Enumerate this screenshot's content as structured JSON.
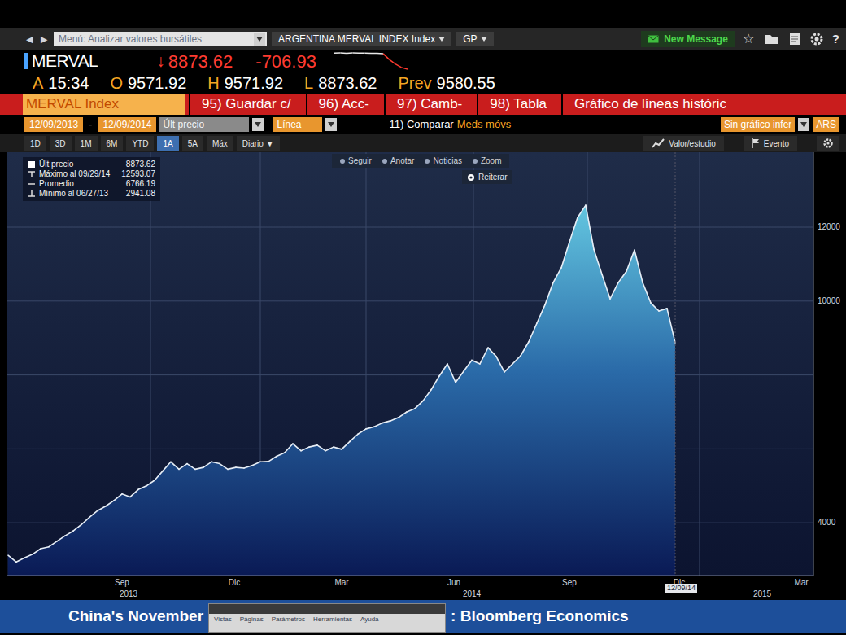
{
  "toolbar": {
    "nav": [
      "◀",
      "▶"
    ],
    "menu": "Menú: Analizar valores bursátiles",
    "security": "ARGENTINA MERVAL INDEX Index",
    "function": "GP",
    "new_message": "New Message",
    "star": "☆",
    "help": "?"
  },
  "quote": {
    "ticker": "MERVAL",
    "arrow": "↓",
    "last": "8873.62",
    "change": "-706.93",
    "time_label": "A",
    "time": "15:34",
    "open_label": "O",
    "open": "9571.92",
    "high_label": "H",
    "high": "9571.92",
    "low_label": "L",
    "low": "8873.62",
    "prev_label": "Prev",
    "prev": "9580.55"
  },
  "sparkline": {
    "values": [
      9580,
      9592,
      9575,
      9588,
      9580,
      9584,
      9570,
      9578,
      9560,
      9300,
      9100,
      8950,
      8873
    ]
  },
  "actions": {
    "title": "MERVAL Index",
    "buttons": [
      "95) Guardar c/",
      "96) Acc-",
      "97) Camb-",
      "98) Tabla"
    ],
    "chart_type": "Gráfico de líneas históric"
  },
  "settings": {
    "start": "12/09/2013",
    "sep": "-",
    "end": "12/09/2014",
    "field": "Últ precio",
    "style": "Línea",
    "compare": "11) Comparar",
    "moving_avg": "Meds móvs",
    "lower": "Sin gráfico infer",
    "currency": "ARS"
  },
  "periods": [
    {
      "label": "1D",
      "selected": false
    },
    {
      "label": "3D",
      "selected": false
    },
    {
      "label": "1M",
      "selected": false
    },
    {
      "label": "6M",
      "selected": false
    },
    {
      "label": "YTD",
      "selected": false
    },
    {
      "label": "1A",
      "selected": true
    },
    {
      "label": "5A",
      "selected": false
    },
    {
      "label": "Máx",
      "selected": false
    }
  ],
  "frequency": "Diario ▼",
  "right_tools": [
    "Valor/estudio",
    "Evento"
  ],
  "chart": {
    "legend": [
      {
        "label": "Últ precio",
        "value": "8873.62"
      },
      {
        "label": "Máximo al 09/29/14",
        "value": "12593.07"
      },
      {
        "label": "Promedio",
        "value": "6766.19"
      },
      {
        "label": "Mínimo al 06/27/13",
        "value": "2941.08"
      }
    ],
    "tools": [
      "Seguir",
      "Anotar",
      "Noticias",
      "Zoom"
    ],
    "reset": "Reiterar",
    "y_ticks": [
      "12000",
      "10000",
      "4000"
    ],
    "months": [
      "Sep",
      "Dic",
      "Mar",
      "Jun",
      "Sep",
      "Dic",
      "Mar"
    ],
    "years": [
      "2013",
      "2014",
      "2015"
    ],
    "cursor_date": "12/09/14",
    "series": [
      {
        "name": "MERVAL",
        "values": [
          3120,
          2941,
          3050,
          3150,
          3300,
          3350,
          3500,
          3650,
          3780,
          3950,
          4150,
          4330,
          4450,
          4600,
          4780,
          4700,
          4900,
          5000,
          5150,
          5400,
          5650,
          5450,
          5600,
          5450,
          5500,
          5650,
          5600,
          5450,
          5500,
          5480,
          5550,
          5650,
          5660,
          5800,
          5900,
          6140,
          5950,
          6050,
          6100,
          5950,
          6050,
          5990,
          6200,
          6400,
          6540,
          6600,
          6700,
          6760,
          6850,
          7000,
          7090,
          7300,
          7600,
          7970,
          8300,
          7800,
          8100,
          8400,
          8300,
          8740,
          8500,
          8080,
          8300,
          8520,
          8900,
          9400,
          9900,
          10500,
          10900,
          11600,
          12260,
          12593,
          11400,
          10720,
          10060,
          10500,
          10800,
          11380,
          10500,
          9950,
          9730,
          9800,
          8873.62
        ]
      }
    ]
  },
  "ticker_bar": {
    "left": "China's November",
    "window_menu": [
      "Vistas",
      "Páginas",
      "Parámetros",
      "Herramientas",
      "Ayuda"
    ],
    "right": ": Bloomberg Economics"
  }
}
